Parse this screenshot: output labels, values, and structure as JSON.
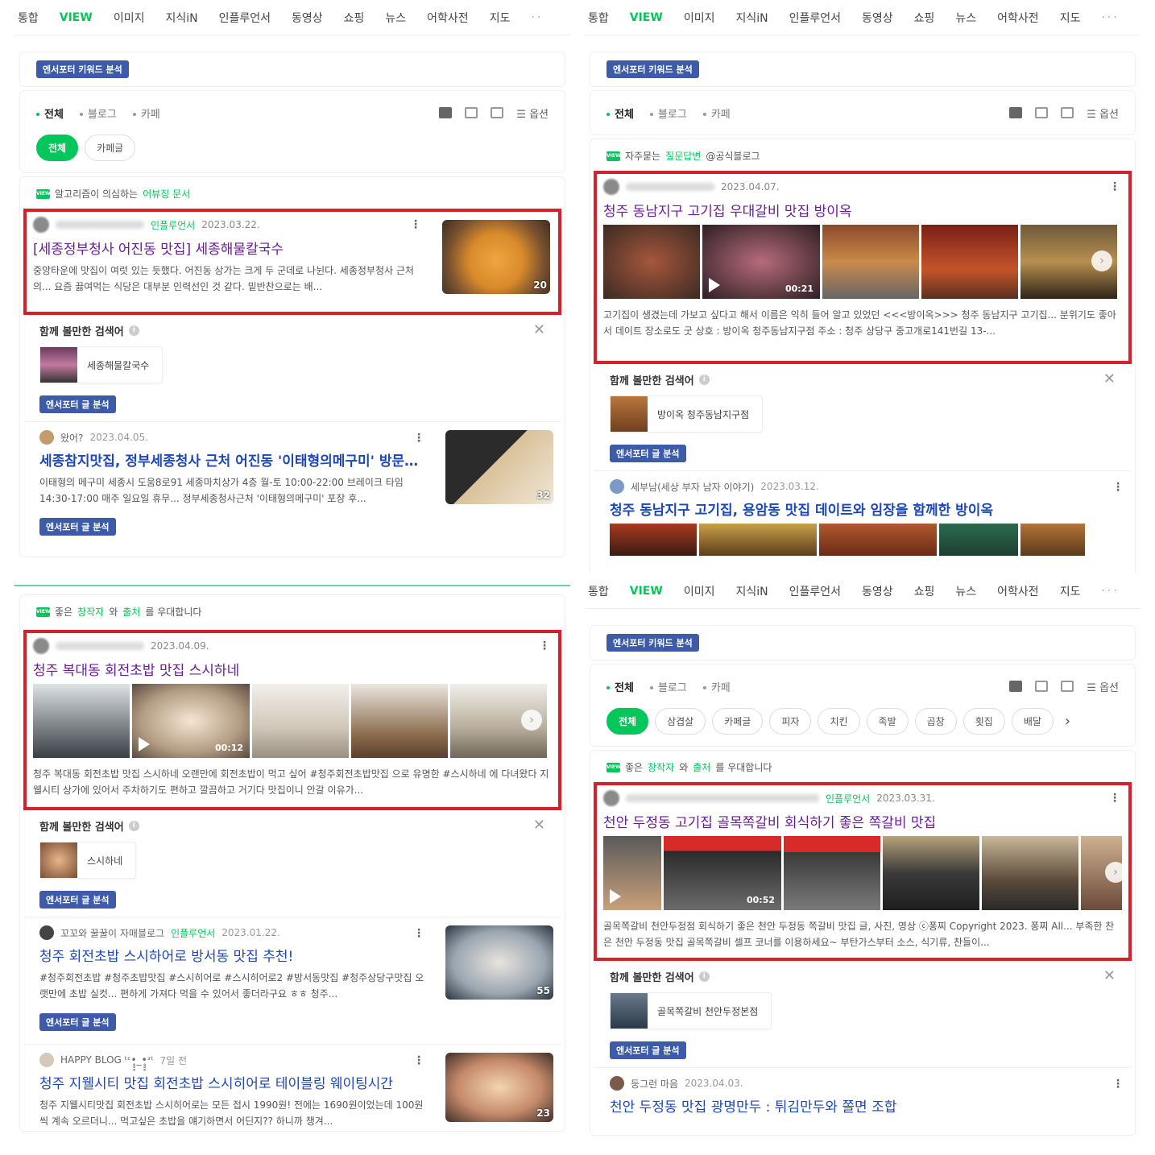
{
  "tabs": [
    "통합",
    "VIEW",
    "이미지",
    "지식iN",
    "인플루언서",
    "동영상",
    "쇼핑",
    "뉴스",
    "어학사전",
    "지도",
    "···"
  ],
  "tabs_left": [
    "통합",
    "VIEW",
    "이미지",
    "지식iN",
    "인플루언서",
    "동영상",
    "쇼핑",
    "뉴스",
    "어학사전",
    "지도",
    "··"
  ],
  "keyword_badge": "엔서포터 키워드 분석",
  "post_badge": "엔서포터 글 분석",
  "filters": {
    "all": "전체",
    "blog": "블로그",
    "cafe": "카페",
    "options": "옵션"
  },
  "p1": {
    "chips": [
      "전체",
      "카페글"
    ],
    "section": {
      "pre": "알고리즘이 의심하는 ",
      "hl": "어뷰징 문서"
    },
    "post1": {
      "infl": "인플루언서",
      "date": "2023.03.22.",
      "title": "[세종정부청사 어진동 맛집] 세종해물칼국수",
      "desc": "중앙타운에 맛집이 여럿 있는 듯했다. 어진동 상가는 크게 두 군데로 나뉜다. 세종정부청사 근처의... 요즘 끓여먹는 식당은 대부분 인력선인 것 같다. 밑반찬으로는 배...",
      "count": "20"
    },
    "related": {
      "heading": "함께 볼만한 검색어",
      "chip": "세종해물칼국수"
    },
    "post2": {
      "author": "왔어?",
      "date": "2023.04.05.",
      "title": "세종참지맛집, 정부세종청사 근처 어진동 '이태형의메구미' 방문포...",
      "desc": "이태형의 메구미 세종시 도움8로91 세종마치상가 4층 월-토 10:00-22:00 브레이크 타임 14:30-17:00 매주 일요일 휴무... 정부세종청사근처 '이태형의메구미' 포장 후...",
      "count": "32"
    }
  },
  "p2": {
    "section": {
      "pre": "자주묻는 ",
      "hl": "질문답변",
      "post": " @공식블로그"
    },
    "post1": {
      "date": "2023.04.07.",
      "title": "청주 동남지구 고기집 우대갈비 맛집 방이옥",
      "duration": "00:21",
      "desc": "고기집이 생겼는데 가보고 싶다고 해서 이름은 익히 들어 알고 있었던 <<<방이옥>>> 청주 동남지구 고기집... 분위기도 좋아서 데이트 장소로도 굿 상호 : 방이옥 청주동남지구점 주소 : 청주 상당구 중고개로141번길 13-..."
    },
    "related": {
      "heading": "함께 볼만한 검색어",
      "chip": "방이옥 청주동남지구점"
    },
    "post2": {
      "author": "세부남(세상 부자 남자 이야기)",
      "date": "2023.03.12.",
      "title": "청주 동남지구 고기집, 용암동 맛집 데이트와 임장을 함께한 방이옥"
    }
  },
  "p3": {
    "section": {
      "pre": "좋은 ",
      "hl1": "창작자",
      "mid": "와 ",
      "hl2": "출처",
      "post": "를 우대합니다"
    },
    "post1": {
      "date": "2023.04.09.",
      "title": "청주 복대동 회전초밥 맛집 스시하네",
      "duration": "00:12",
      "desc": "청주 복대동 회전초밥 맛집 스시하네 오랜만에 회전초밥이 먹고 싶어 #청주회전초밥맛집 으로 유명한 #스시하네 에 다녀왔다 지웰시티 상가에 있어서 주차하기도 편하고 깔끔하고 거기다 맛집이니 안갈 이유가..."
    },
    "related": {
      "heading": "함께 볼만한 검색어",
      "chip": "스시하네"
    },
    "post2": {
      "author": "꼬꼬와 꿀꿀이 자매블로그",
      "infl": "인플루언서",
      "date": "2023.01.22.",
      "title": "청주 회전초밥 스시하어로 방서동 맛집 추천!",
      "desc": "#청주회전초밥 #청주초밥맛집 #스시히어로 #스시히어로2 #방서동맛집 #청주상당구맛집 오랫만에 초밥 실컷... 편하게 가져다 먹을 수 있어서 좋더라구요 ㅎㅎ 청주...",
      "count": "55"
    },
    "post3": {
      "author": "HAPPY BLOG ᵗᵋ•̥̥̥_•̥̥̥ᵌᵗ",
      "date": "7일 전",
      "title": "청주 지웰시티 맛집 회전초밥 스시히어로 테이블링 웨이팅시간",
      "desc": "청주 지웰시티맛집 회전초밥 스시히어로는 모든 접시 1990원! 전에는 1690원이었는데 100원씩 계속 오르더니... 먹고싶은 초밥을 얘기하면서 어딘지?? 하니까 챙겨...",
      "count": "23"
    }
  },
  "p4": {
    "chips": [
      "전체",
      "삼겹살",
      "카페글",
      "피자",
      "치킨",
      "족발",
      "곱창",
      "횟집",
      "배달"
    ],
    "section": {
      "pre": "좋은 ",
      "hl1": "창작자",
      "mid": "와 ",
      "hl2": "출처",
      "post": "를 우대합니다"
    },
    "post1": {
      "infl": "인플루언서",
      "date": "2023.03.31.",
      "title": "천안 두정동 고기집 골목쪽갈비 회식하기 좋은 쪽갈비 맛집",
      "duration": "00:52",
      "desc": "골목쪽갈비 천안두정점 회식하기 좋은 천안 두정동 쪽갈비 맛집 글, 사진, 영상 ⓒ퐁찌 Copyright 2023. 퐁찌 All... 부족한 찬은 천안 두정동 맛집 골목쪽갈비 셀프 코너를 이용하세요~ 부탄가스부터 소스, 식기류, 찬들이..."
    },
    "related": {
      "heading": "함께 볼만한 검색어",
      "chip": "골목쪽갈비 천안두정본점"
    },
    "post2": {
      "author": "둥그런 마음",
      "date": "2023.04.03.",
      "title": "천안 두정동 맛집 광명만두 : 튀김만두와 쫄면 조합"
    }
  },
  "colors": {
    "naver_green": "#03c75a",
    "badge_blue": "#3d5ba9",
    "highlight_red": "#d7202a",
    "title_purple": "#6a1b9a",
    "title_blue": "#1c47b7"
  }
}
